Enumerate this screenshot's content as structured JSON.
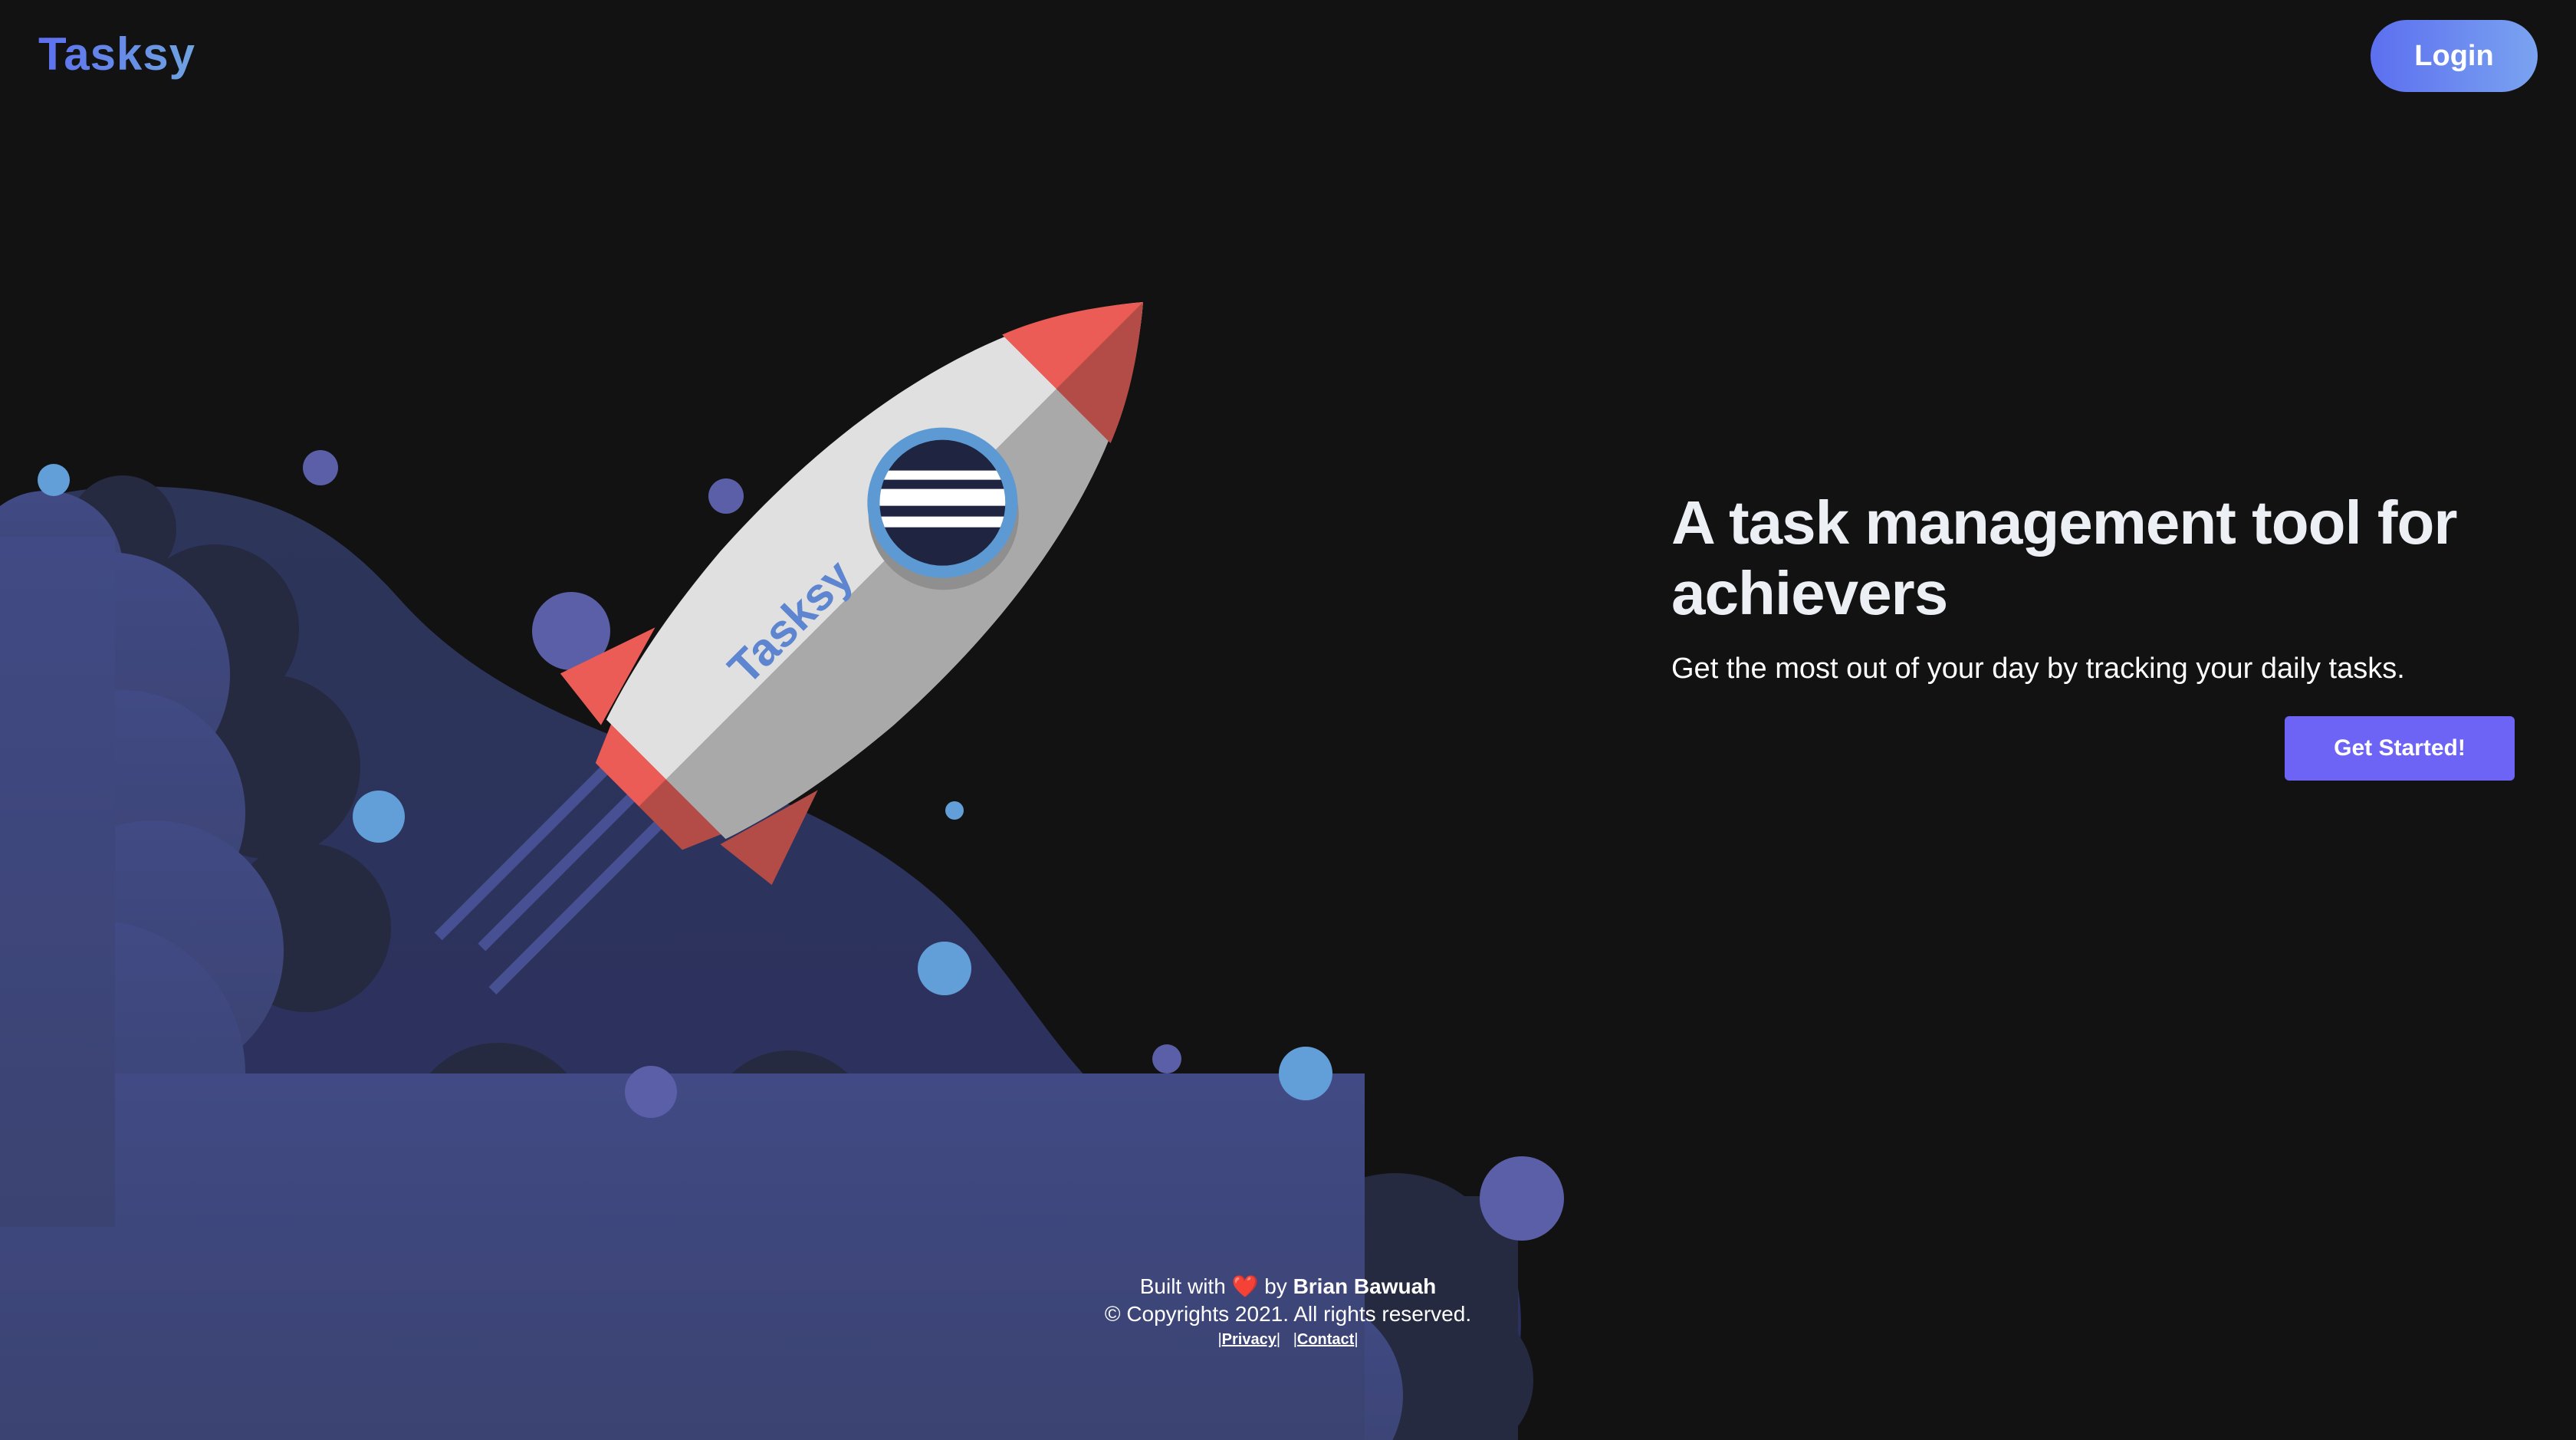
{
  "header": {
    "logo": "Tasksy",
    "login_label": "Login"
  },
  "hero": {
    "title": "A task management tool for achievers",
    "subtitle": "Get the most out of your day by tracking your daily tasks.",
    "cta_label": "Get Started!"
  },
  "illustration": {
    "rocket_text": "Tasksy"
  },
  "footer": {
    "built_with": "Built with",
    "heart": "❤️",
    "by": "by",
    "author": "Brian Bawuah",
    "copyright": "© Copyrights 2021. All rights reserved.",
    "privacy_label": "Privacy",
    "contact_label": "Contact",
    "separator": "|"
  },
  "colors": {
    "background": "#121212",
    "accent": "#6d63f5",
    "logo_gradient_start": "#5c6ff0",
    "logo_gradient_end": "#6fa4e0",
    "cloud_light": "#434a7e",
    "cloud_dark": "#262a40",
    "rocket_red": "#ea5c55"
  }
}
